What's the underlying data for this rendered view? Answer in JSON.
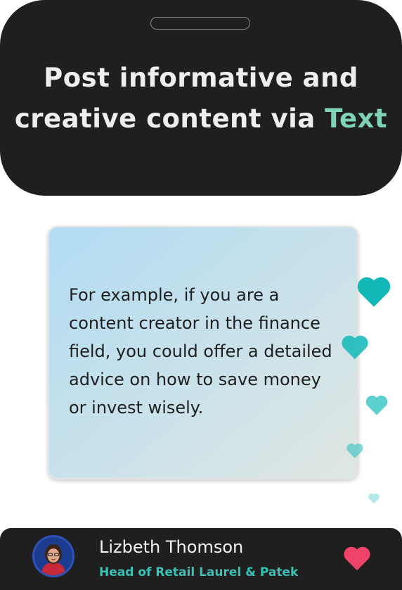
{
  "header": {
    "title_line1": "Post informative and",
    "title_line2_prefix": "creative content via ",
    "title_highlight": "Text",
    "accent_color": "#7fd3b8"
  },
  "post": {
    "text": "For example, if you are a content creator in the finance field, you could offer a detailed advice on how to save money or invest wisely."
  },
  "author": {
    "name": "Lizbeth Thomson",
    "role": "Head of Retail Laurel & Patek"
  },
  "icons": {
    "floating": "heart-icon",
    "like": "heart-icon",
    "floating_color": "#12b8b8",
    "like_color": "#f0436a"
  }
}
